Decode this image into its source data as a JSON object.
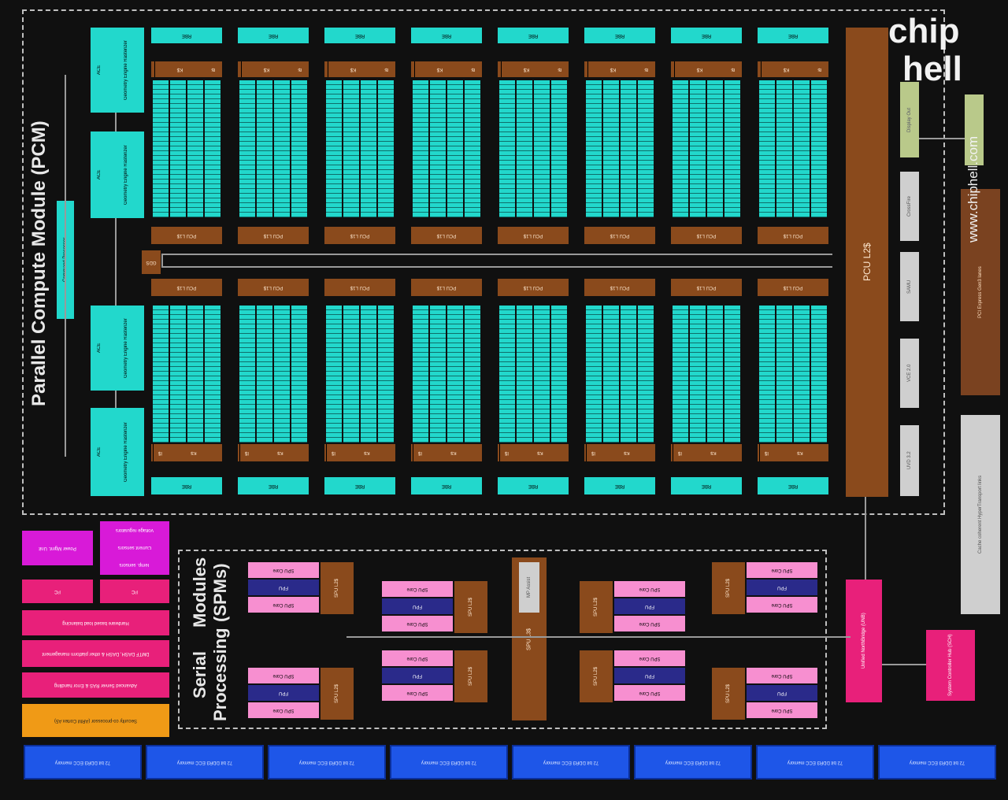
{
  "pcm": {
    "title": "Parallel Compute Module (PCM)",
    "command_processor": "Command Processor",
    "ace_label": "ACE",
    "geometry_label": "Geometry Engine Rasterizer",
    "gds_label": "GDS",
    "rbe_label": "RBE",
    "ks_label": "K$",
    "is_label": "I$",
    "pcu_l1_label": "PCU L1$",
    "pcu_l2_label": "PCU L2$"
  },
  "io": {
    "display_out": "Display Out",
    "crossfire": "CrossFire",
    "samu": "SAMU",
    "vce": "VCE 2.0",
    "uvd": "UVD 3.2",
    "pci_express": "PCI Express Gen3 lanes",
    "cache_coherent": "Cache coherent HyperTransport links",
    "unified_northbridge": "Unified NorthBridge (UNB)",
    "system_controller": "System Controller Hub (SCH)"
  },
  "spm": {
    "title_line1": "Serial Processing",
    "title_line2": "Modules (SPMs)",
    "spu_core": "SPU Core",
    "fpu": "FPU",
    "spu_l2": "SPU L2$",
    "spu_l3": "SPU L3$",
    "mp_assist": "MP Assist"
  },
  "left_blocks": {
    "power_mgmt": "Power Mgmt. Unit",
    "thermal_sensors": "Temp. sensors",
    "current_sensors": "Current sensors",
    "voltage_regulators": "Voltage regulators",
    "i2c_a": "I²C",
    "i2c_b": "I²C",
    "hw_load_balancing": "Hardware based load balancing",
    "platform_management": "DMTF DASH, DASH & other platform management",
    "advanced_server_ras": "Advanced Server RAS & Error handling",
    "security_coprocessor": "Security co-processor (ARM Cortex A5)"
  },
  "memory": {
    "channel_label": "72 bit DDR3 ECC memory",
    "channels": 8
  },
  "watermark": {
    "logo_top": "chip",
    "logo_bottom": "hell",
    "url": "www.chiphell.com"
  },
  "colors": {
    "cyan": "#22d8cc",
    "brown": "#8a4a1c",
    "pink": "#e8207a",
    "magenta": "#d81ad8",
    "light_pink": "#f78fd0",
    "orange": "#f09a16",
    "blue": "#1e56e8",
    "gray": "#cfcfcf",
    "green": "#b9c98a"
  }
}
